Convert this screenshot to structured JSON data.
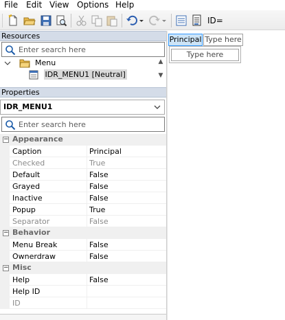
{
  "menubar": {
    "items": [
      "File",
      "Edit",
      "View",
      "Options",
      "Help"
    ]
  },
  "toolbar": {
    "buttons": [
      "new-file-icon",
      "open-folder-icon",
      "save-icon",
      "print-preview-icon",
      "cut-icon",
      "copy-icon",
      "paste-icon",
      "undo-icon",
      "redo-icon",
      "properties-icon",
      "resource-symbols-icon"
    ],
    "id_label": "ID="
  },
  "resources": {
    "header": "Resources",
    "search_placeholder": "Enter search here",
    "tree": [
      {
        "label": "Menu",
        "icon": "folder-icon",
        "expanded": true
      },
      {
        "label": "IDR_MENU1 [Neutral]",
        "icon": "menu-resource-icon",
        "selected": true
      }
    ]
  },
  "properties": {
    "header": "Properties",
    "object": "IDR_MENU1",
    "search_placeholder": "Enter search here",
    "categories": [
      {
        "name": "Appearance",
        "rows": [
          {
            "name": "Caption",
            "value": "Principal",
            "disabled": false
          },
          {
            "name": "Checked",
            "value": "True",
            "disabled": true
          },
          {
            "name": "Default",
            "value": "False",
            "disabled": false
          },
          {
            "name": "Grayed",
            "value": "False",
            "disabled": false
          },
          {
            "name": "Inactive",
            "value": "False",
            "disabled": false
          },
          {
            "name": "Popup",
            "value": "True",
            "disabled": false
          },
          {
            "name": "Separator",
            "value": "False",
            "disabled": true
          }
        ]
      },
      {
        "name": "Behavior",
        "rows": [
          {
            "name": "Menu Break",
            "value": "False",
            "disabled": false
          },
          {
            "name": "Ownerdraw",
            "value": "False",
            "disabled": false
          }
        ]
      },
      {
        "name": "Misc",
        "rows": [
          {
            "name": "Help",
            "value": "False",
            "disabled": false
          },
          {
            "name": "Help ID",
            "value": "",
            "disabled": false
          },
          {
            "name": "ID",
            "value": "",
            "disabled": true
          }
        ]
      }
    ]
  },
  "editor": {
    "top_items": [
      "Principal",
      "Type here"
    ],
    "dropdown_item": "Type here"
  },
  "colors": {
    "panel_header": "#d4dce8",
    "selection": "#cce4f7",
    "selection_border": "#3399ff",
    "folder": "#e8b84a"
  }
}
